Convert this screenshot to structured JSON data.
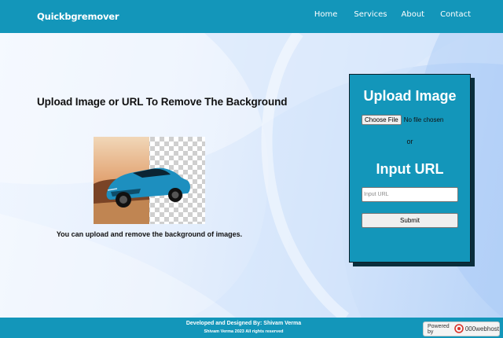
{
  "navbar": {
    "brand": "Quickbgremover",
    "links": [
      "Home",
      "Services",
      "About",
      "Contact"
    ]
  },
  "main": {
    "headline": "Upload Image or URL To Remove The Background",
    "caption": "You can upload and remove the background of images."
  },
  "upload_panel": {
    "title": "Upload Image",
    "choose_file_label": "Choose File",
    "file_status": "No file chosen",
    "or_text": "or",
    "url_title": "Input URL",
    "url_placeholder": "Input URL",
    "url_value": "",
    "submit_label": "Submit"
  },
  "footer": {
    "credit": "Developed and Designed By: Shivam Verma",
    "rights": "Shivam Verma 2023 All rights reserved"
  },
  "badge": {
    "powered_by": "Powered by",
    "host": "000webhost"
  },
  "colors": {
    "brand_teal": "#1396ba",
    "panel_border": "#0c1f28",
    "car_blue": "#1d8fbf"
  },
  "icons": {
    "badge_icon": "000webhost-logo-icon"
  }
}
